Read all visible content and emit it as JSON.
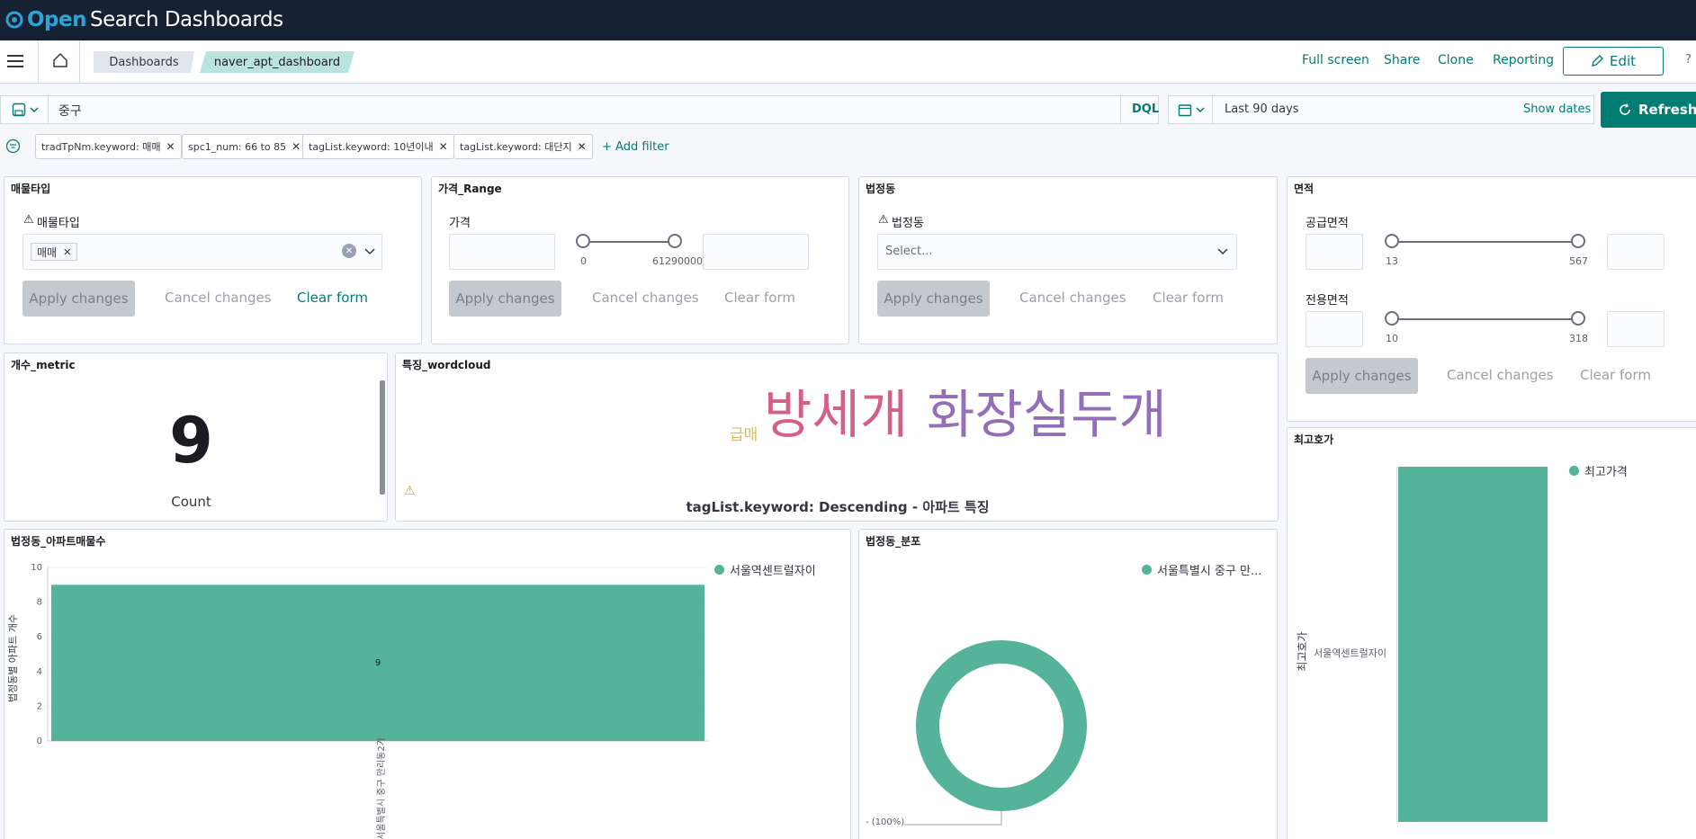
{
  "header": {
    "brand_open": "Open",
    "brand_rest": "Search Dashboards"
  },
  "nav": {
    "breadcrumbs": [
      "Dashboards",
      "naver_apt_dashboard"
    ],
    "links": [
      "Full screen",
      "Share",
      "Clone",
      "Reporting"
    ],
    "edit_label": "Edit"
  },
  "query": {
    "value": "중구",
    "language": "DQL",
    "time_range": "Last 90 days",
    "show_dates": "Show dates",
    "refresh": "Refresh"
  },
  "filters": [
    "tradTpNm.keyword: 매매",
    "spc1_num: 66 to 85",
    "tagList.keyword: 10년이내",
    "tagList.keyword: 대단지"
  ],
  "add_filter": "+ Add filter",
  "controls": {
    "apply": "Apply changes",
    "cancel": "Cancel changes",
    "clear": "Clear form"
  },
  "panel_type": {
    "title": "매물타입",
    "label": "매물타입",
    "selected": "매매"
  },
  "panel_price": {
    "title": "가격_Range",
    "label": "가격",
    "min": "0",
    "max": "61290000"
  },
  "panel_dong": {
    "title": "법정동",
    "label": "법정동",
    "placeholder": "Select..."
  },
  "panel_area": {
    "title": "면적",
    "supply_label": "공급면적",
    "supply_min": "13",
    "supply_max": "567",
    "exclusive_label": "전용면적",
    "exclusive_min": "10",
    "exclusive_max": "318"
  },
  "panel_metric": {
    "title": "개수_metric",
    "value": "9",
    "label": "Count"
  },
  "panel_wordcloud": {
    "title": "특징_wordcloud",
    "words": [
      "급매",
      "방세개",
      "화장실두개"
    ],
    "caption": "tagList.keyword: Descending - 아파트 특징"
  },
  "panel_bar": {
    "title": "법정동_아파트매물수",
    "legend": "서울역센트럴자이",
    "ylabel": "법정동별 아파트 개수",
    "xlabel": "서울특별시 중구 만리동2가"
  },
  "panel_pie": {
    "title": "법정동_분포",
    "legend": "서울특별시 중구 만...",
    "label": "- (100%)"
  },
  "panel_maxprice": {
    "title": "최고호가",
    "legend": "최고가격",
    "ylabel": "최고호가",
    "category": "서울역센트럴자이"
  },
  "chart_data": [
    {
      "type": "bar",
      "title": "법정동_아파트매물수",
      "categories": [
        "서울특별시 중구 만리동2가"
      ],
      "series": [
        {
          "name": "서울역센트럴자이",
          "values": [
            9
          ]
        }
      ],
      "ylabel": "법정동별 아파트 개수",
      "ylim": [
        0,
        10
      ],
      "yticks": [
        0,
        2,
        4,
        6,
        8,
        10
      ],
      "data_labels": [
        "9"
      ],
      "color": "#54b399"
    },
    {
      "type": "pie",
      "title": "법정동_분포",
      "slices": [
        {
          "name": "서울특별시 중구 만...",
          "value": 100
        }
      ],
      "color": "#54b399"
    }
  ],
  "colors": {
    "accent": "#017d73",
    "series": "#54b399",
    "topbar": "#162233"
  }
}
